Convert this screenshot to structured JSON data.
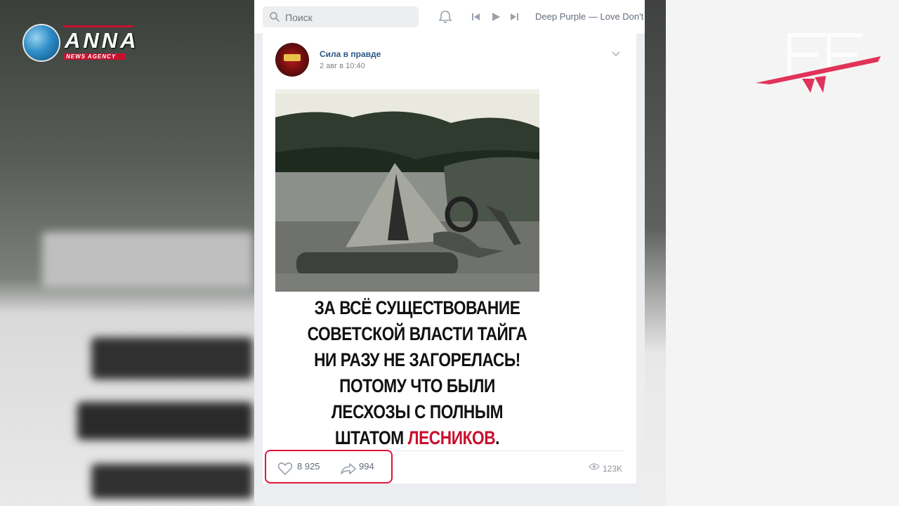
{
  "search": {
    "placeholder": "Поиск"
  },
  "player": {
    "track": "Deep Purple — Love Don't"
  },
  "post": {
    "author": "Сила в правде",
    "date": "2 авг в 10:40",
    "caption_lines": [
      "ЗА ВСЁ СУЩЕСТВОВАНИЕ",
      "СОВЕТСКОЙ ВЛАСТИ ТАЙГА",
      "НИ РАЗУ НЕ ЗАГОРЕЛАСЬ!",
      "ПОТОМУ ЧТО БЫЛИ",
      "ЛЕСХОЗЫ С ПОЛНЫМ"
    ],
    "caption_last_plain": "ШТАТОМ ",
    "caption_last_red": "ЛЕСНИКОВ",
    "caption_last_end": ".",
    "likes": "8 925",
    "shares": "994",
    "views": "123K"
  },
  "logo": {
    "name": "ANNA",
    "sub": "NEWS AGENCY"
  },
  "colors": {
    "accent_red": "#c8102e",
    "vk_link": "#2a5885",
    "highlight": "#e0163b"
  }
}
